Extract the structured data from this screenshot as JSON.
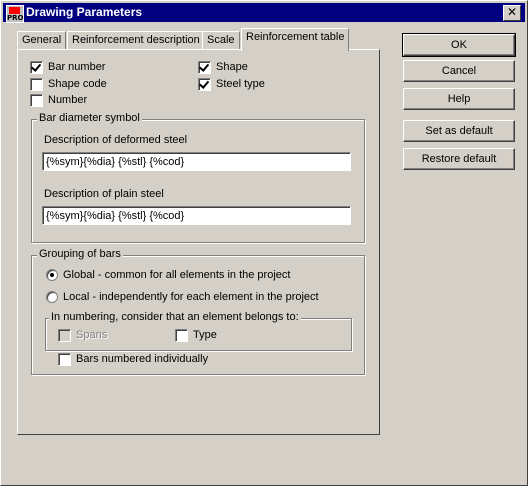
{
  "window": {
    "title": "Drawing Parameters",
    "app_icon_text": "PRO",
    "close_glyph": "✕"
  },
  "tabs": [
    {
      "label": "General",
      "active": false
    },
    {
      "label": "Reinforcement description",
      "active": false
    },
    {
      "label": "Scale",
      "active": false
    },
    {
      "label": "Reinforcement table",
      "active": true
    }
  ],
  "options": {
    "bar_number": {
      "label": "Bar number",
      "checked": true
    },
    "shape_code": {
      "label": "Shape code",
      "checked": false
    },
    "number": {
      "label": "Number",
      "checked": false
    },
    "shape": {
      "label": "Shape",
      "checked": true
    },
    "steel_type": {
      "label": "Steel type",
      "checked": true
    }
  },
  "bar_diameter": {
    "title": "Bar diameter symbol",
    "deformed_label": "Description of deformed steel",
    "deformed_value": "{%sym}{%dia} {%stl} {%cod}",
    "plain_label": "Description of plain steel",
    "plain_value": "{%sym}{%dia} {%stl} {%cod}"
  },
  "grouping": {
    "title": "Grouping of bars",
    "global_label": "Global - common for all elements in the project",
    "local_label": "Local - independently for each element in the project",
    "selected": "global",
    "numbering_title": "In numbering, consider that an element belongs to:",
    "spans_label": "Spans",
    "type_label": "Type",
    "individual_label": "Bars numbered individually"
  },
  "buttons": {
    "ok": "OK",
    "cancel": "Cancel",
    "help": "Help",
    "set_default": "Set as default",
    "restore_default": "Restore default"
  }
}
